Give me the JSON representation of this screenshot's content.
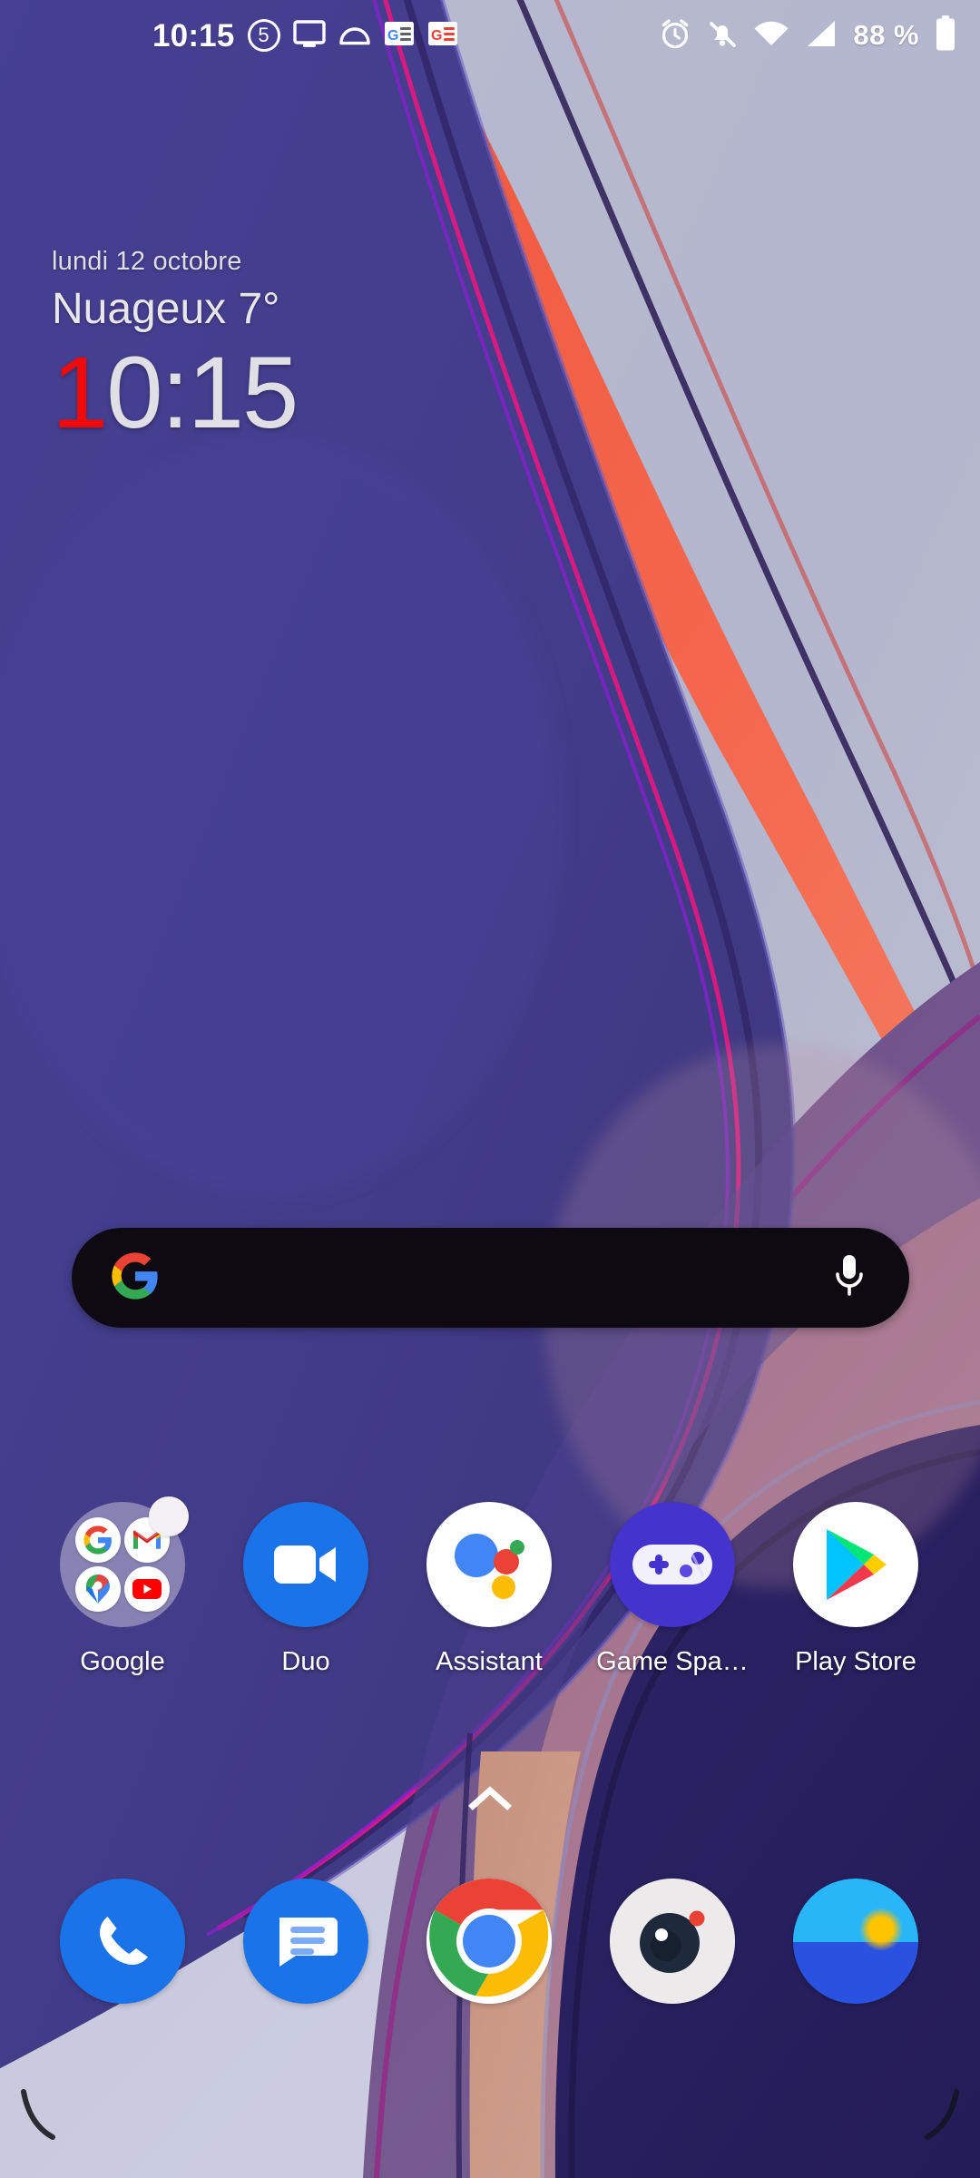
{
  "status_bar": {
    "time": "10:15",
    "notification_count": "5",
    "left_icons": [
      {
        "name": "screen-cast-icon",
        "label": "cast"
      },
      {
        "name": "do-not-disturb-dome-icon",
        "label": "dnd"
      },
      {
        "name": "google-news-icon",
        "label": "news"
      },
      {
        "name": "google-news-alt-icon",
        "label": "news-alt"
      }
    ],
    "right_icons": [
      {
        "name": "alarm-icon",
        "label": "alarm"
      },
      {
        "name": "notifications-muted-icon",
        "label": "ringer-off"
      },
      {
        "name": "wifi-icon",
        "label": "wifi"
      },
      {
        "name": "cellular-signal-icon",
        "label": "signal"
      }
    ],
    "battery_percent": "88 %"
  },
  "clock_widget": {
    "date": "lundi 12 octobre",
    "weather": "Nuageux 7°",
    "time_red": "1",
    "time_rest": "0:15"
  },
  "search": {
    "placeholder": "",
    "value": "",
    "google_logo": "google-g-logo",
    "mic_icon": "microphone-icon"
  },
  "app_grid": [
    {
      "label": "Google",
      "icon": "google-folder-icon",
      "type": "folder",
      "folder_items": [
        "google-g-icon",
        "gmail-icon",
        "google-maps-icon",
        "youtube-icon"
      ],
      "has_badge": true
    },
    {
      "label": "Duo",
      "icon": "google-duo-icon",
      "type": "app",
      "has_badge": false
    },
    {
      "label": "Assistant",
      "icon": "google-assistant-icon",
      "type": "app",
      "has_badge": false
    },
    {
      "label": "Game Spa…",
      "icon": "game-space-icon",
      "type": "app",
      "has_badge": false
    },
    {
      "label": "Play Store",
      "icon": "google-play-store-icon",
      "type": "app",
      "has_badge": false
    }
  ],
  "drawer": {
    "handle_icon": "chevron-up-icon"
  },
  "dock": [
    {
      "label": "Phone",
      "icon": "phone-icon"
    },
    {
      "label": "Messages",
      "icon": "messages-icon"
    },
    {
      "label": "Chrome",
      "icon": "chrome-icon"
    },
    {
      "label": "Camera",
      "icon": "camera-icon"
    },
    {
      "label": "Weather",
      "icon": "weather-icon"
    }
  ],
  "colors": {
    "wallpaper_background": "#b6b8cf",
    "wallpaper_indigo": "#413a86",
    "wallpaper_deep_indigo": "#2a2163",
    "wallpaper_orange": "#f2624a",
    "wallpaper_mauve": "#8d5f7e",
    "wallpaper_rose": "#a97288",
    "wallpaper_magenta_line": "#e8177f",
    "wallpaper_tan": "#c89683",
    "search_bar_background": "#0d0b11",
    "clock_accent_red": "#f30808",
    "label_text": "#ffffff",
    "status_text": "#ffffff"
  }
}
